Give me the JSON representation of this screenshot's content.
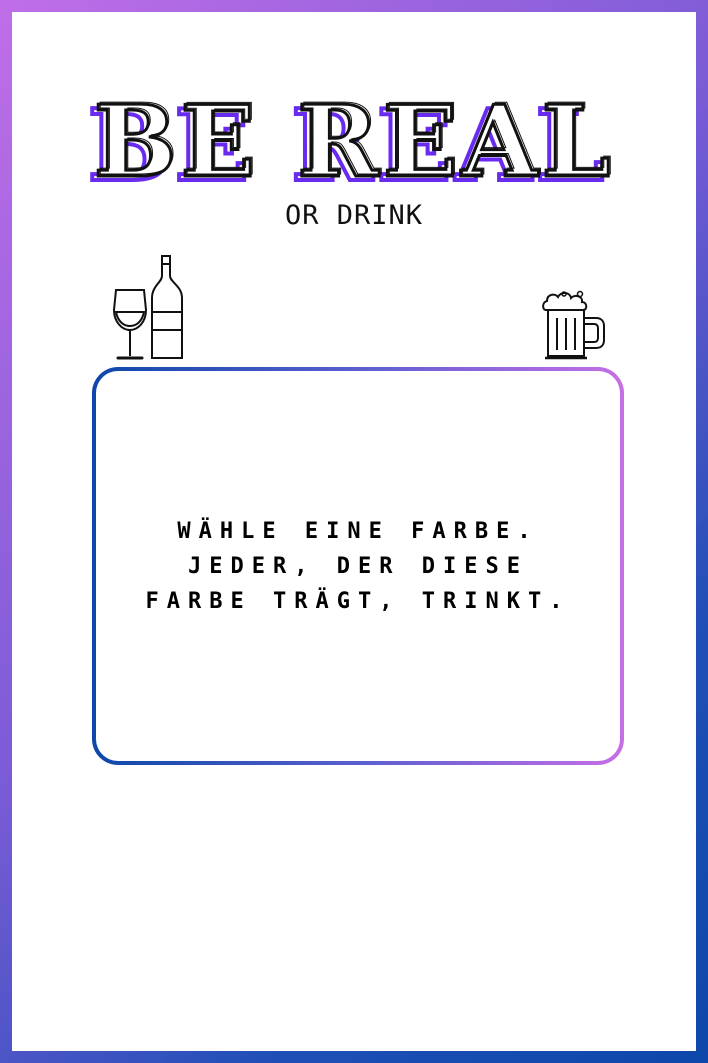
{
  "title": "BE REAL",
  "subtitle": "OR DRINK",
  "card": {
    "lines": [
      "WÄHLE EINE FARBE.",
      "JEDER, DER DIESE",
      "FARBE TRÄGT, TRINKT."
    ]
  },
  "icons": {
    "left": "wine-glass-and-bottle-icon",
    "right": "beer-mug-icon"
  },
  "colors": {
    "accent_purple": "#6a2bf0",
    "gradient_start": "#0d47a9",
    "gradient_end": "#c76ee6",
    "text": "#111111"
  }
}
